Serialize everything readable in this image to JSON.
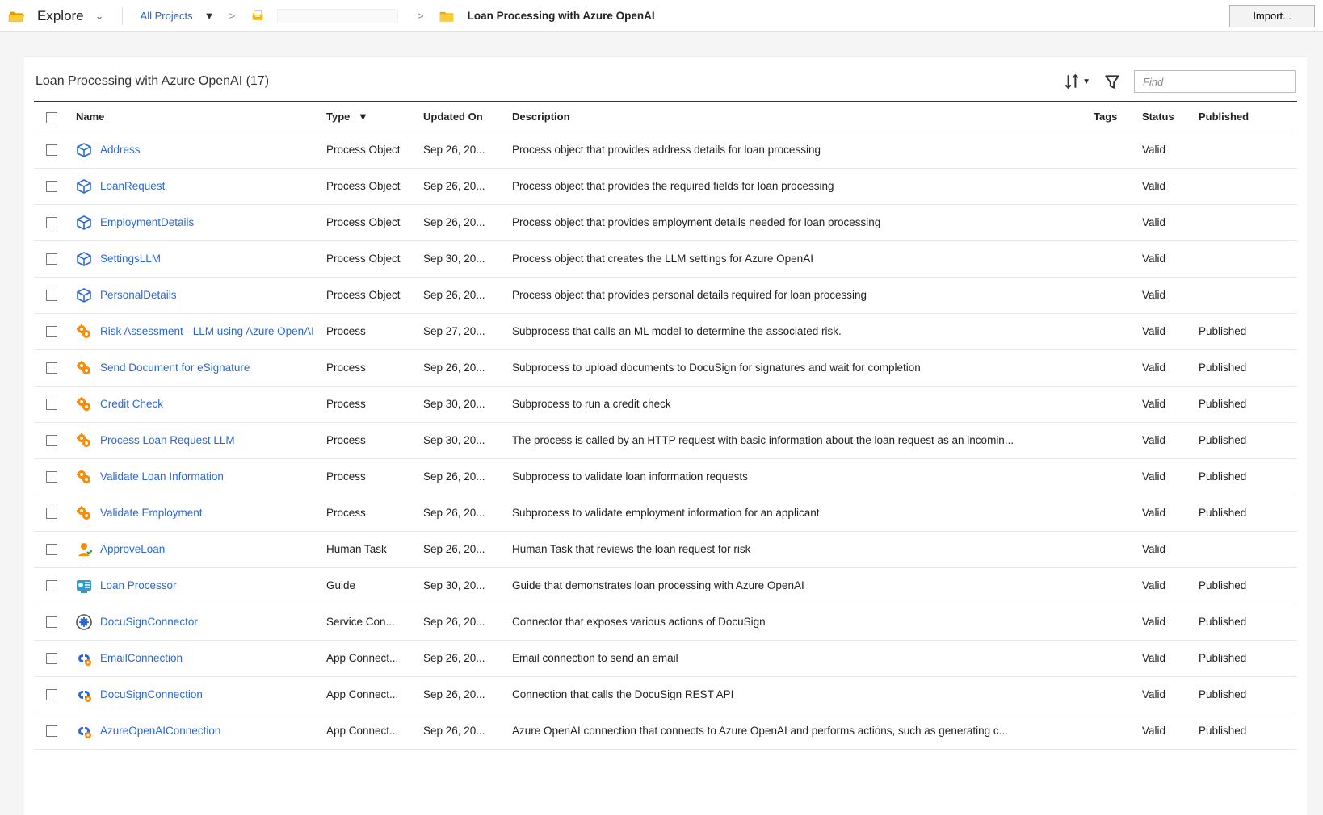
{
  "topbar": {
    "explore_label": "Explore",
    "breadcrumb_root": "All Projects",
    "breadcrumb_current": "Loan Processing with Azure OpenAI",
    "import_label": "Import..."
  },
  "panel": {
    "title": "Loan Processing with Azure OpenAI (17)",
    "find_placeholder": "Find"
  },
  "columns": {
    "name": "Name",
    "type": "Type",
    "updated": "Updated On",
    "description": "Description",
    "tags": "Tags",
    "status": "Status",
    "published": "Published"
  },
  "rows": [
    {
      "icon": "process-object",
      "name": "Address",
      "type": "Process Object",
      "updated": "Sep 26, 20...",
      "description": "Process object that provides address details for loan processing",
      "tags": "",
      "status": "Valid",
      "published": ""
    },
    {
      "icon": "process-object",
      "name": "LoanRequest",
      "type": "Process Object",
      "updated": "Sep 26, 20...",
      "description": "Process object that provides the required fields for loan processing",
      "tags": "",
      "status": "Valid",
      "published": ""
    },
    {
      "icon": "process-object",
      "name": "EmploymentDetails",
      "type": "Process Object",
      "updated": "Sep 26, 20...",
      "description": "Process object that provides employment details needed for loan processing",
      "tags": "",
      "status": "Valid",
      "published": ""
    },
    {
      "icon": "process-object",
      "name": "SettingsLLM",
      "type": "Process Object",
      "updated": "Sep 30, 20...",
      "description": "Process object that creates the LLM settings for Azure OpenAI",
      "tags": "",
      "status": "Valid",
      "published": ""
    },
    {
      "icon": "process-object",
      "name": "PersonalDetails",
      "type": "Process Object",
      "updated": "Sep 26, 20...",
      "description": "Process object that provides personal details required for loan processing",
      "tags": "",
      "status": "Valid",
      "published": ""
    },
    {
      "icon": "process",
      "name": "Risk Assessment - LLM using Azure OpenAI",
      "type": "Process",
      "updated": "Sep 27, 20...",
      "description": "Subprocess that calls an ML model to determine the associated risk.",
      "tags": "",
      "status": "Valid",
      "published": "Published"
    },
    {
      "icon": "process",
      "name": "Send Document for eSignature",
      "type": "Process",
      "updated": "Sep 26, 20...",
      "description": "Subprocess to upload documents to DocuSign for signatures and wait for completion",
      "tags": "",
      "status": "Valid",
      "published": "Published"
    },
    {
      "icon": "process",
      "name": "Credit Check",
      "type": "Process",
      "updated": "Sep 30, 20...",
      "description": "Subprocess to run a credit check",
      "tags": "",
      "status": "Valid",
      "published": "Published"
    },
    {
      "icon": "process",
      "name": "Process Loan Request LLM",
      "type": "Process",
      "updated": "Sep 30, 20...",
      "description": "The process is called by an HTTP request with basic information about the loan request as an incomin...",
      "tags": "",
      "status": "Valid",
      "published": "Published"
    },
    {
      "icon": "process",
      "name": "Validate Loan Information",
      "type": "Process",
      "updated": "Sep 26, 20...",
      "description": "Subprocess to validate loan information requests",
      "tags": "",
      "status": "Valid",
      "published": "Published"
    },
    {
      "icon": "process",
      "name": "Validate Employment",
      "type": "Process",
      "updated": "Sep 26, 20...",
      "description": "Subprocess to validate employment information for an applicant",
      "tags": "",
      "status": "Valid",
      "published": "Published"
    },
    {
      "icon": "human-task",
      "name": "ApproveLoan",
      "type": "Human Task",
      "updated": "Sep 26, 20...",
      "description": "Human Task that reviews the loan request for risk",
      "tags": "",
      "status": "Valid",
      "published": ""
    },
    {
      "icon": "guide",
      "name": "Loan Processor",
      "type": "Guide",
      "updated": "Sep 30, 20...",
      "description": "Guide that demonstrates loan processing with Azure OpenAI",
      "tags": "",
      "status": "Valid",
      "published": "Published"
    },
    {
      "icon": "service-connector",
      "name": "DocuSignConnector",
      "type": "Service Con...",
      "updated": "Sep 26, 20...",
      "description": "Connector that exposes various actions of DocuSign",
      "tags": "",
      "status": "Valid",
      "published": "Published"
    },
    {
      "icon": "app-connection",
      "name": "EmailConnection",
      "type": "App Connect...",
      "updated": "Sep 26, 20...",
      "description": "Email connection to send an email",
      "tags": "",
      "status": "Valid",
      "published": "Published"
    },
    {
      "icon": "app-connection",
      "name": "DocuSignConnection",
      "type": "App Connect...",
      "updated": "Sep 26, 20...",
      "description": "Connection that calls the DocuSign REST API",
      "tags": "",
      "status": "Valid",
      "published": "Published"
    },
    {
      "icon": "app-connection",
      "name": "AzureOpenAIConnection",
      "type": "App Connect...",
      "updated": "Sep 26, 20...",
      "description": "Azure OpenAI connection that connects to Azure OpenAI and performs actions, such as generating c...",
      "tags": "",
      "status": "Valid",
      "published": "Published"
    }
  ]
}
